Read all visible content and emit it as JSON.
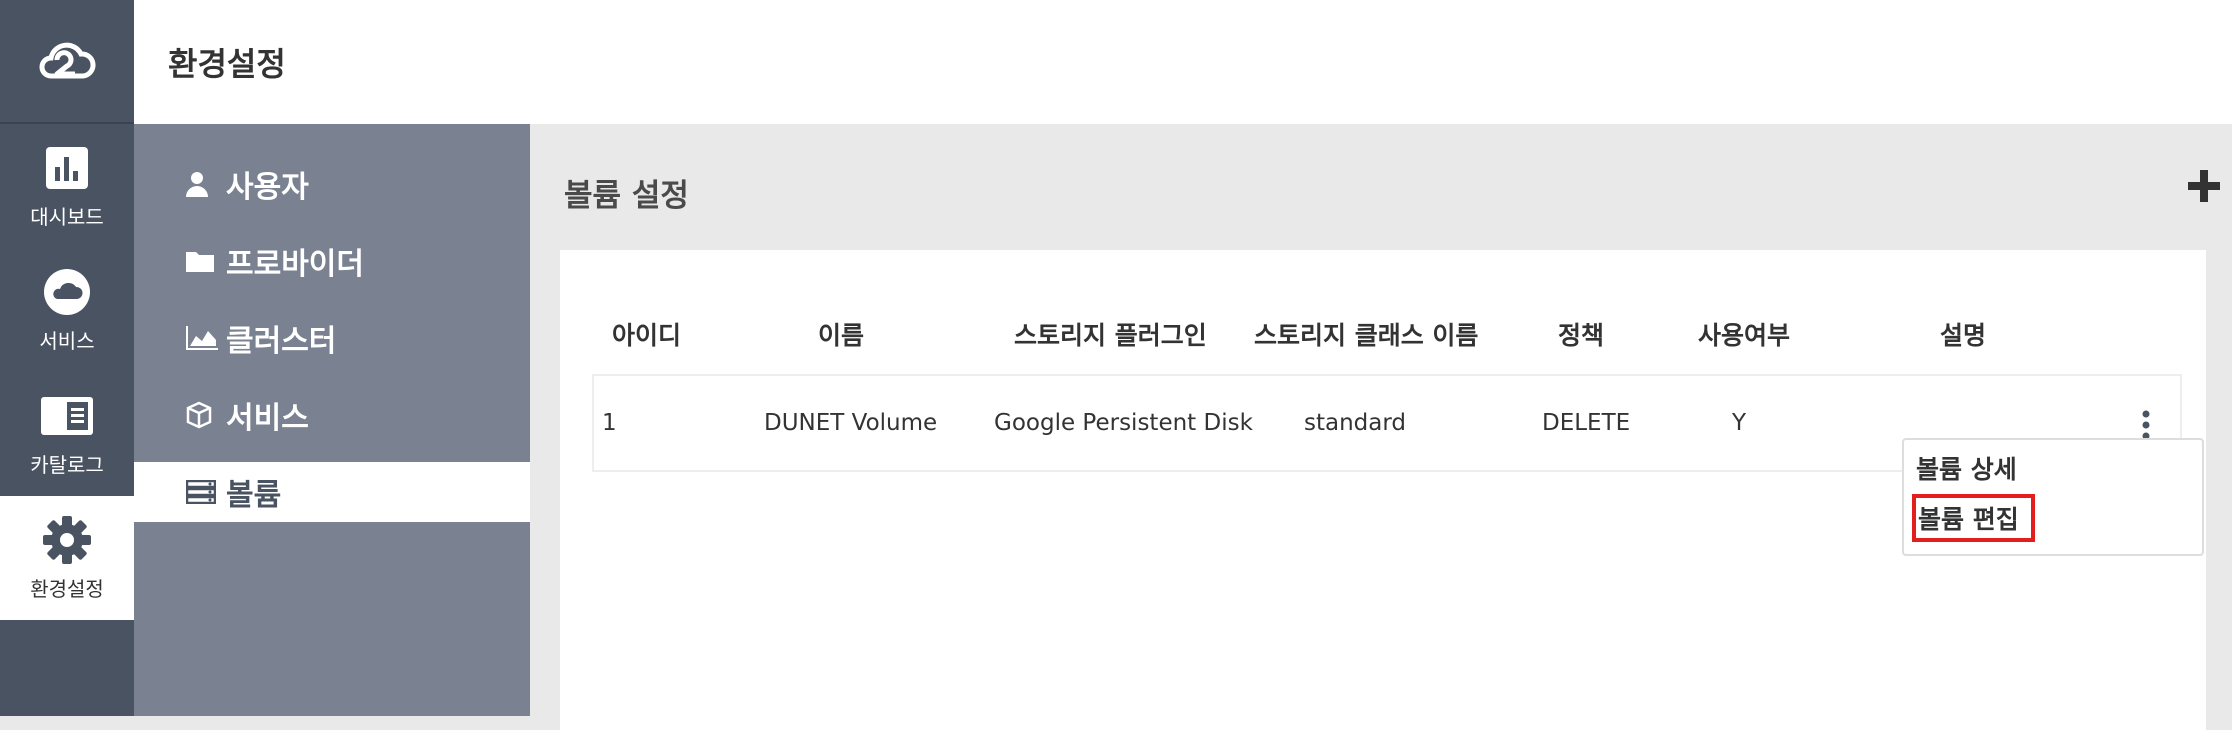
{
  "rail": {
    "items": [
      {
        "label": "대시보드",
        "icon": "bar-chart-icon"
      },
      {
        "label": "서비스",
        "icon": "cloud-icon"
      },
      {
        "label": "카탈로그",
        "icon": "catalog-icon"
      },
      {
        "label": "환경설정",
        "icon": "gear-icon"
      }
    ]
  },
  "header": {
    "title": "환경설정"
  },
  "submenu": {
    "items": [
      {
        "label": "사용자",
        "icon": "user-icon"
      },
      {
        "label": "프로바이더",
        "icon": "folder-icon"
      },
      {
        "label": "클러스터",
        "icon": "area-chart-icon"
      },
      {
        "label": "서비스",
        "icon": "cube-icon"
      },
      {
        "label": "볼륨",
        "icon": "server-icon"
      }
    ]
  },
  "main": {
    "title": "볼륨 설정",
    "table": {
      "columns": [
        "아이디",
        "이름",
        "스토리지 플러그인",
        "스토리지 클래스 이름",
        "정책",
        "사용여부",
        "설명"
      ],
      "rows": [
        [
          "1",
          "DUNET Volume",
          "Google Persistent Disk",
          "standard",
          "DELETE",
          "Y",
          ""
        ]
      ]
    },
    "dropdown": [
      "볼륨 상세",
      "볼륨 편집"
    ]
  },
  "colors": {
    "rail": "#4a5362",
    "submenu": "#7a8190",
    "highlight": "#e31e1e"
  }
}
